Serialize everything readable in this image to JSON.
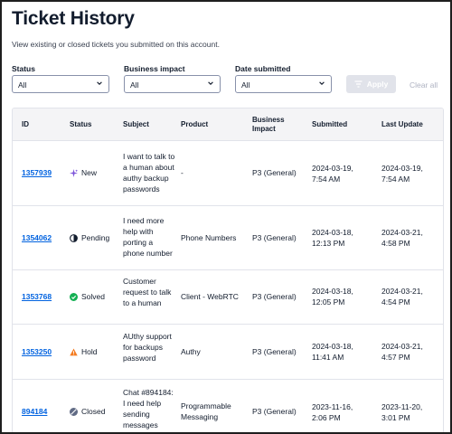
{
  "page": {
    "title": "Ticket History",
    "description": "View existing or closed tickets you submitted on this account."
  },
  "filters": {
    "status": {
      "label": "Status",
      "value": "All"
    },
    "impact": {
      "label": "Business impact",
      "value": "All"
    },
    "date": {
      "label": "Date submitted",
      "value": "All"
    },
    "apply_label": "Apply",
    "clear_label": "Clear all"
  },
  "table": {
    "headers": {
      "id": "ID",
      "status": "Status",
      "subject": "Subject",
      "product": "Product",
      "impact": "Business Impact",
      "submitted": "Submitted",
      "updated": "Last Update"
    },
    "rows": [
      {
        "id": "1357939",
        "status": "New",
        "status_icon": "sparkle-icon",
        "subject": "I want to talk to a human about authy backup passwords",
        "product": "-",
        "impact": "P3 (General)",
        "submitted": "2024-03-19, 7:54 AM",
        "updated": "2024-03-19, 7:54 AM"
      },
      {
        "id": "1354062",
        "status": "Pending",
        "status_icon": "pending-icon",
        "subject": "I need more help with porting a phone number",
        "product": "Phone Numbers",
        "impact": "P3 (General)",
        "submitted": "2024-03-18, 12:13 PM",
        "updated": "2024-03-21, 4:58 PM"
      },
      {
        "id": "1353768",
        "status": "Solved",
        "status_icon": "check-circle-icon",
        "subject": "Customer request to talk to a human",
        "product": "Client - WebRTC",
        "impact": "P3 (General)",
        "submitted": "2024-03-18, 12:05 PM",
        "updated": "2024-03-21, 4:54 PM"
      },
      {
        "id": "1353250",
        "status": "Hold",
        "status_icon": "warning-icon",
        "subject": "AUthy support for backups password",
        "product": "Authy",
        "impact": "P3 (General)",
        "submitted": "2024-03-18, 11:41 AM",
        "updated": "2024-03-21, 4:57 PM"
      },
      {
        "id": "894184",
        "status": "Closed",
        "status_icon": "closed-icon",
        "subject": "Chat #894184: I need help sending messages",
        "product": "Programmable Messaging",
        "impact": "P3 (General)",
        "submitted": "2023-11-16, 2:06 PM",
        "updated": "2023-11-20, 3:01 PM"
      }
    ]
  },
  "colors": {
    "link": "#0263e0",
    "new": "#7e56da",
    "pending": "#121c2d",
    "solved": "#14b053",
    "hold": "#f47c22",
    "closed": "#606b85"
  }
}
